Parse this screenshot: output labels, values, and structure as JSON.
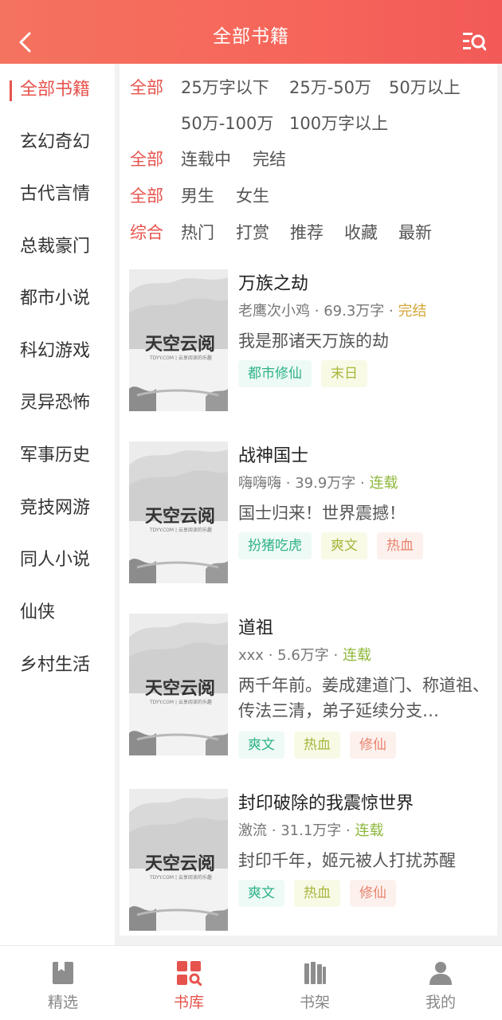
{
  "header": {
    "title": "全部书籍"
  },
  "sidebar": {
    "items": [
      {
        "label": "全部书籍",
        "active": true
      },
      {
        "label": "玄幻奇幻"
      },
      {
        "label": "古代言情"
      },
      {
        "label": "总裁豪门"
      },
      {
        "label": "都市小说"
      },
      {
        "label": "科幻游戏"
      },
      {
        "label": "灵异恐怖"
      },
      {
        "label": "军事历史"
      },
      {
        "label": "竞技网游"
      },
      {
        "label": "同人小说"
      },
      {
        "label": "仙侠"
      },
      {
        "label": "乡村生活"
      }
    ]
  },
  "filters": {
    "words": [
      "全部",
      "25万字以下",
      "25万-50万",
      "50万以上",
      "50万-100万",
      "100万字以上"
    ],
    "status": [
      "全部",
      "连载中",
      "完结"
    ],
    "gender": [
      "全部",
      "男生",
      "女生"
    ],
    "sort": [
      "综合",
      "热门",
      "打赏",
      "推荐",
      "收藏",
      "最新"
    ]
  },
  "cover": {
    "brand": "天空云阅",
    "slogan": "TDYY.COM | 云享阅读的乐趣"
  },
  "books": [
    {
      "title": "万族之劫",
      "author": "老鹰次小鸡",
      "words": "69.3万字",
      "status": "完结",
      "desc": "我是那诸天万族的劫",
      "tags": [
        "都市修仙",
        "末日"
      ]
    },
    {
      "title": "战神国士",
      "author": "嗨嗨嗨",
      "words": "39.9万字",
      "status": "连载",
      "desc": "国士归来！世界震撼！",
      "tags": [
        "扮猪吃虎",
        "爽文",
        "热血"
      ]
    },
    {
      "title": "道祖",
      "author": "xxx",
      "words": "5.6万字",
      "status": "连载",
      "desc": "两千年前。姜成建道门、称道祖、传法三清，弟子延续分支…",
      "tags": [
        "爽文",
        "热血",
        "修仙"
      ]
    },
    {
      "title": "封印破除的我震惊世界",
      "author": "激流",
      "words": "31.1万字",
      "status": "连载",
      "desc": "封印千年，姬元被人打扰苏醒",
      "tags": [
        "爽文",
        "热血",
        "修仙"
      ]
    }
  ],
  "bottom_nav": [
    {
      "label": "精选",
      "icon": "bookmark-book-icon"
    },
    {
      "label": "书库",
      "icon": "library-grid-search-icon",
      "active": true
    },
    {
      "label": "书架",
      "icon": "bookshelf-icon"
    },
    {
      "label": "我的",
      "icon": "user-icon"
    }
  ],
  "colors": {
    "accent": "#e6534d",
    "header_gradient_start": "#f4735f",
    "header_gradient_end": "#f25a58",
    "finished": "#d4a63a",
    "serializing": "#8fb83c"
  }
}
